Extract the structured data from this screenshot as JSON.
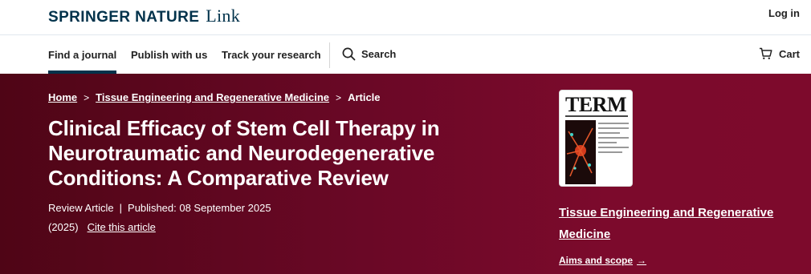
{
  "header": {
    "brand_main": "SPRINGER NATURE",
    "brand_link": "Link",
    "login": "Log in"
  },
  "nav": {
    "items": [
      {
        "label": "Find a journal",
        "active": true
      },
      {
        "label": "Publish with us",
        "active": false
      },
      {
        "label": "Track your research",
        "active": false
      }
    ],
    "search_label": "Search",
    "cart_label": "Cart"
  },
  "breadcrumb": {
    "home": "Home",
    "journal": "Tissue Engineering and Regenerative Medicine",
    "current": "Article",
    "separator": ">"
  },
  "article": {
    "title": "Clinical Efficacy of Stem Cell Therapy in Neurotraumatic and Neurodegenerative Conditions: A Comparative Review",
    "type": "Review Article",
    "published": "Published: 08 September 2025",
    "year": "(2025)",
    "cite": "Cite this article"
  },
  "journal": {
    "cover_title": "TERM",
    "name": "Tissue Engineering and Regenerative Medicine",
    "aims": "Aims and scope",
    "aims_arrow": "→"
  },
  "colors": {
    "brand": "#01324b",
    "hero_start": "#4f0516",
    "hero_end": "#7d0a2c"
  }
}
